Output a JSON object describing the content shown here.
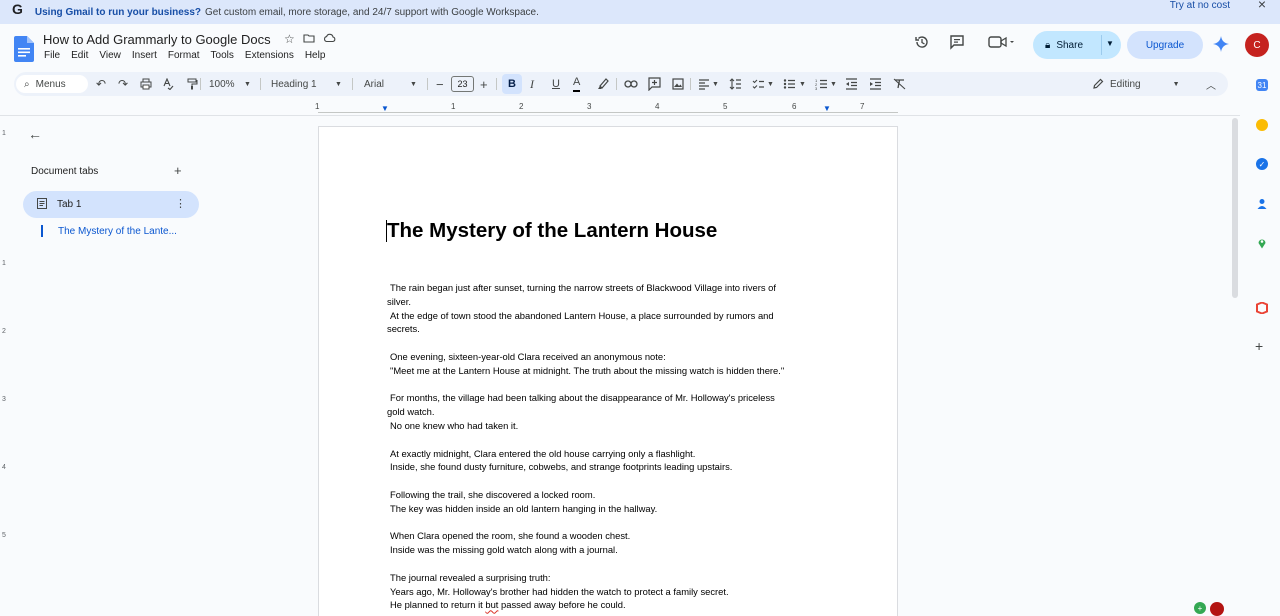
{
  "banner": {
    "logo": "G",
    "bold_text": "Using Gmail to run your business?",
    "text": "Get custom email, more storage, and 24/7 support with Google Workspace.",
    "cta": "Try at no cost",
    "close": "×"
  },
  "header": {
    "doc_title": "How to Add Grammarly to Google Docs",
    "menu": [
      "File",
      "Edit",
      "View",
      "Insert",
      "Format",
      "Tools",
      "Extensions",
      "Help"
    ],
    "share_label": "Share",
    "upgrade_label": "Upgrade",
    "avatar_letter": "C"
  },
  "toolbar": {
    "search_label": "Menus",
    "zoom": "100%",
    "style": "Heading 1",
    "font": "Arial",
    "font_size": "23",
    "mode": "Editing"
  },
  "ruler": {
    "h_numbers": [
      "1",
      "1",
      "2",
      "3",
      "4",
      "5",
      "6",
      "7"
    ],
    "v_numbers": [
      "1",
      "1",
      "2",
      "3",
      "4",
      "5"
    ]
  },
  "sidebar": {
    "heading": "Document tabs",
    "tab_label": "Tab 1",
    "outline_item": "The Mystery of the Lante..."
  },
  "document": {
    "title": "The Mystery of the Lantern House",
    "paragraphs": [
      [
        "The rain began just after sunset, turning the narrow streets of Blackwood Village into rivers of",
        "silver.",
        "At the edge of town stood the abandoned Lantern House, a place surrounded by rumors and",
        "secrets."
      ],
      [
        "One evening, sixteen-year-old Clara received an anonymous note:",
        "\"Meet me at the Lantern House at midnight. The truth about the missing watch is hidden there.\""
      ],
      [
        "For months, the village had been talking about the disappearance of Mr. Holloway's priceless",
        "gold watch.",
        "No one knew who had taken it."
      ],
      [
        "At exactly midnight, Clara entered the old house carrying only a flashlight.",
        "Inside, she found dusty furniture, cobwebs, and strange footprints leading upstairs."
      ],
      [
        "Following the trail, she discovered a locked room.",
        "The key was hidden inside an old lantern hanging in the hallway."
      ],
      [
        "When Clara opened the room, she found a wooden chest.",
        "Inside was the missing gold watch along with a journal."
      ],
      [
        "The journal revealed a surprising truth:",
        "Years ago, Mr. Holloway's brother had hidden the watch to protect a family secret.",
        "He planned to return it but passed away before he could."
      ]
    ]
  },
  "colors": {
    "accent": "#0b57d0",
    "share_bg": "#c2e7ff",
    "upgrade_bg": "#d3e3fd",
    "avatar_bg": "#c5221f",
    "banner_bg": "#dce7fb"
  },
  "icons": {
    "header": [
      "star-icon",
      "move-folder-icon",
      "cloud-status-icon",
      "history-icon",
      "comments-icon",
      "meet-icon",
      "lock-icon",
      "gemini-icon"
    ],
    "side_panel": [
      "calendar-icon",
      "keep-icon",
      "tasks-icon",
      "contacts-icon",
      "maps-icon",
      "office-icon",
      "add-addon-icon"
    ]
  }
}
